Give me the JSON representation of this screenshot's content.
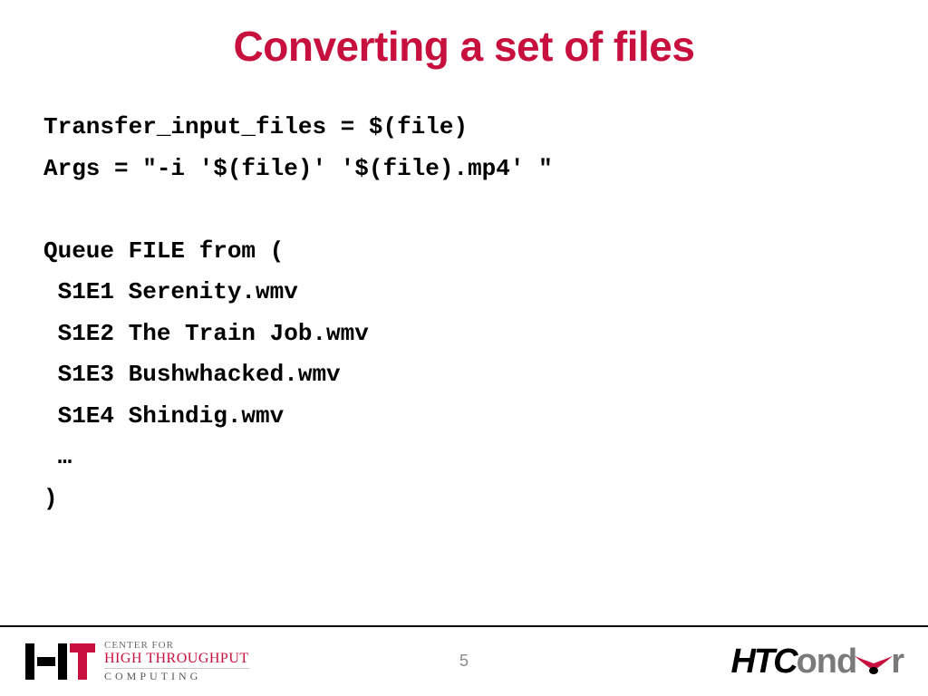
{
  "title": "Converting a set of files",
  "code_lines": [
    "Transfer_input_files = $(file)",
    "Args = \"-i '$(file)' '$(file).mp4' \"",
    "",
    "Queue FILE from (",
    " S1E1 Serenity.wmv",
    " S1E2 The Train Job.wmv",
    " S1E3 Bushwhacked.wmv",
    " S1E4 Shindig.wmv",
    " …",
    ")"
  ],
  "page_number": "5",
  "footer": {
    "left": {
      "line1": "CENTER FOR",
      "line2": "HIGH THROUGHPUT",
      "line3": "COMPUTING"
    },
    "right": {
      "ht": "HT",
      "c": "C",
      "ond": "ond",
      "r": "r"
    }
  }
}
